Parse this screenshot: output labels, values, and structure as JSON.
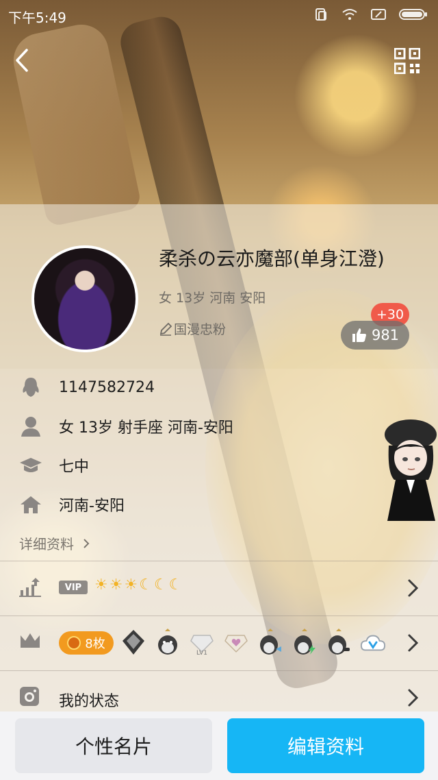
{
  "status_bar": {
    "time": "下午5:49"
  },
  "profile": {
    "nickname": "柔杀の云亦魔部(单身江澄)",
    "basic_info": "女 13岁 河南 安阳",
    "signature": "国漫忠粉",
    "likes": "981",
    "like_increment": "+30"
  },
  "info": {
    "qq_number": "1147582724",
    "personal": "女  13岁  射手座  河南-安阳",
    "school": "七中",
    "hometown": "河南-安阳",
    "detail_link": "详细资料"
  },
  "vip": {
    "tag": "VIP",
    "levels": [
      "☀",
      "☀",
      "☀",
      "☾",
      "☾",
      "☾"
    ]
  },
  "medals": {
    "count": "8枚",
    "badges": [
      "diamond-dark-icon",
      "penguin-icon",
      "diamond-lv1-icon",
      "diamond-heart-icon",
      "penguin-fish-icon",
      "penguin-lightning-icon",
      "penguin-sunglasses-icon",
      "cloud-v-icon"
    ],
    "lv1": "LV1"
  },
  "my_status": {
    "label": "我的状态"
  },
  "actions": {
    "card": "个性名片",
    "edit": "编辑资料"
  },
  "colors": {
    "accent": "#16b6f5",
    "like_badge": "#f05a4a",
    "medal": "#f29a1f"
  }
}
